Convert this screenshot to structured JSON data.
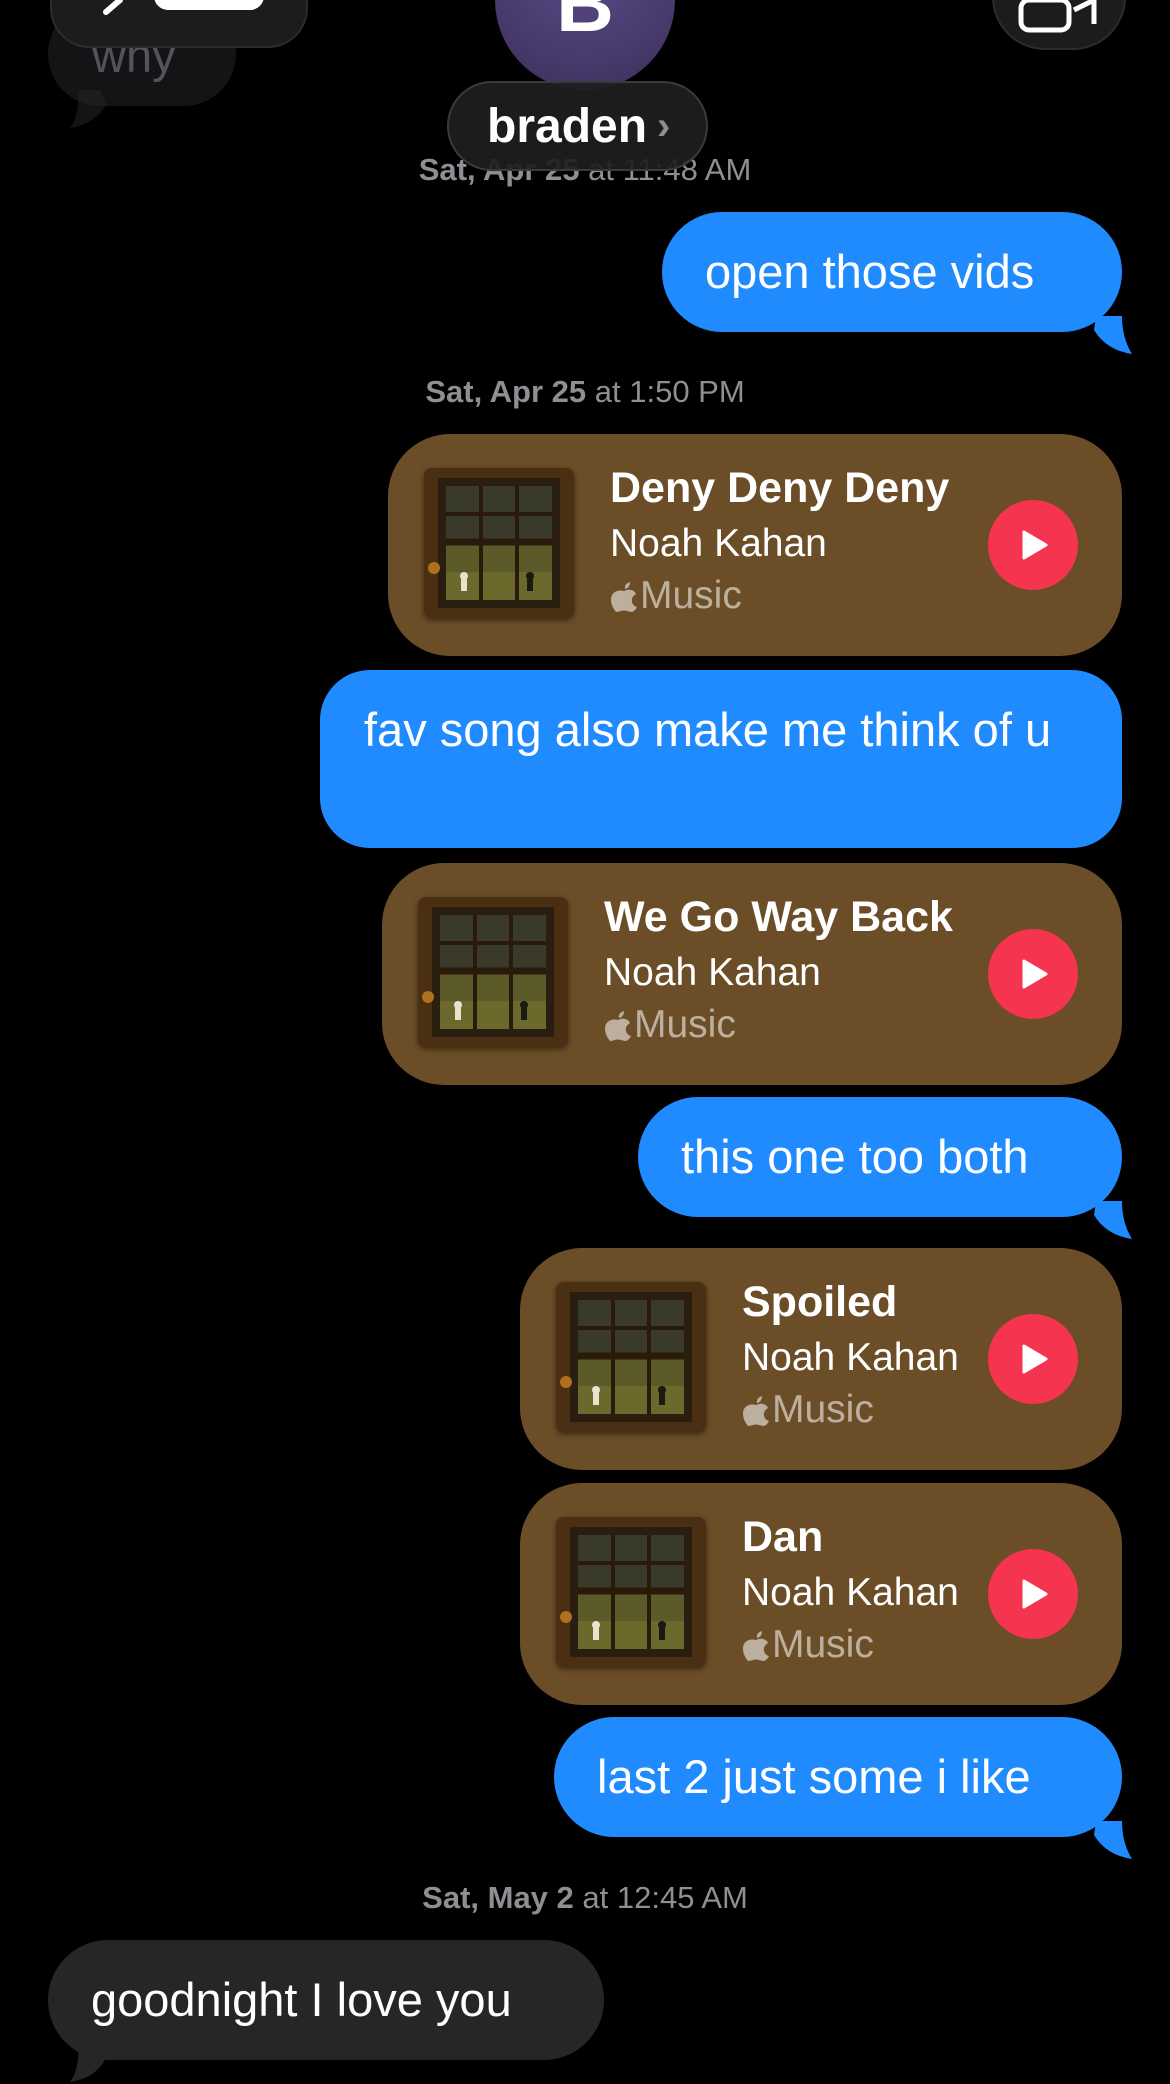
{
  "header": {
    "avatar_initial": "B",
    "contact_name": "braden",
    "chevron": "›"
  },
  "messages": [
    {
      "type": "text",
      "direction": "incoming",
      "text": "why"
    },
    {
      "type": "timestamp",
      "day": "Sat, Apr 25",
      "time": " at 11:48 AM"
    },
    {
      "type": "text",
      "direction": "outgoing",
      "text": "open those vids"
    },
    {
      "type": "timestamp",
      "day": "Sat, Apr 25",
      "time": " at 1:50 PM"
    },
    {
      "type": "music",
      "title": "Deny Deny Deny",
      "artist": "Noah Kahan",
      "service": "Music"
    },
    {
      "type": "text",
      "direction": "outgoing",
      "text": "fav song also make me think of u"
    },
    {
      "type": "music",
      "title": "We Go Way Back",
      "artist": "Noah Kahan",
      "service": "Music"
    },
    {
      "type": "text",
      "direction": "outgoing",
      "text": "this one too both"
    },
    {
      "type": "music",
      "title": "Spoiled",
      "artist": "Noah Kahan",
      "service": "Music"
    },
    {
      "type": "music",
      "title": "Dan",
      "artist": "Noah Kahan",
      "service": "Music"
    },
    {
      "type": "text",
      "direction": "outgoing",
      "text": "last 2 just some i like"
    },
    {
      "type": "timestamp",
      "day": "Sat, May 2",
      "time": " at 12:45 AM"
    },
    {
      "type": "text",
      "direction": "incoming",
      "text": "goodnight I love you"
    }
  ],
  "colors": {
    "outgoing_bubble": "#1f8bff",
    "incoming_bubble": "#262628",
    "music_card": "#6b4e27",
    "play_button": "#f5354f",
    "timestamp": "#8e8e93",
    "background": "#000000"
  },
  "icons": {
    "back": "chevron-left-icon",
    "video": "video-camera-icon",
    "play": "play-icon",
    "service": "apple-logo-icon"
  }
}
